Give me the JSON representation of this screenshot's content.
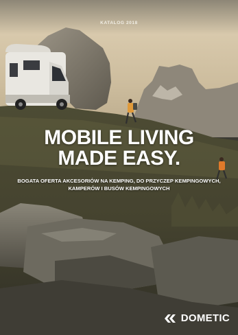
{
  "catalog_label": "KATALOG 2018",
  "headline": {
    "line1": "MOBILE LIVING",
    "line2": "MADE EASY."
  },
  "subheadline": {
    "line1": "BOGATA OFERTA AKCESORIÓW NA KEMPING, DO PRZYCZEP KEMPINGOWYCH,",
    "line2": "KAMPERÓW I BUSÓW KEMPINGOWYCH"
  },
  "brand": {
    "name": "DOMETIC",
    "logo_icon": "double-chevron-icon"
  },
  "colors": {
    "sky_top": "#e7d9bf",
    "sky_bottom": "#c9b89a",
    "rock": "#6e6a5e",
    "grass": "#5b5a3a",
    "text": "#ffffff",
    "hiker_jacket": "#e07a2a"
  }
}
